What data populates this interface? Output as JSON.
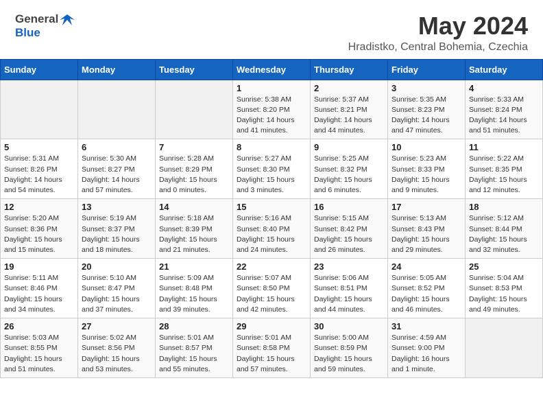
{
  "header": {
    "logo_general": "General",
    "logo_blue": "Blue",
    "month": "May 2024",
    "location": "Hradistko, Central Bohemia, Czechia"
  },
  "weekdays": [
    "Sunday",
    "Monday",
    "Tuesday",
    "Wednesday",
    "Thursday",
    "Friday",
    "Saturday"
  ],
  "weeks": [
    [
      {
        "day": "",
        "info": ""
      },
      {
        "day": "",
        "info": ""
      },
      {
        "day": "",
        "info": ""
      },
      {
        "day": "1",
        "info": "Sunrise: 5:38 AM\nSunset: 8:20 PM\nDaylight: 14 hours\nand 41 minutes."
      },
      {
        "day": "2",
        "info": "Sunrise: 5:37 AM\nSunset: 8:21 PM\nDaylight: 14 hours\nand 44 minutes."
      },
      {
        "day": "3",
        "info": "Sunrise: 5:35 AM\nSunset: 8:23 PM\nDaylight: 14 hours\nand 47 minutes."
      },
      {
        "day": "4",
        "info": "Sunrise: 5:33 AM\nSunset: 8:24 PM\nDaylight: 14 hours\nand 51 minutes."
      }
    ],
    [
      {
        "day": "5",
        "info": "Sunrise: 5:31 AM\nSunset: 8:26 PM\nDaylight: 14 hours\nand 54 minutes."
      },
      {
        "day": "6",
        "info": "Sunrise: 5:30 AM\nSunset: 8:27 PM\nDaylight: 14 hours\nand 57 minutes."
      },
      {
        "day": "7",
        "info": "Sunrise: 5:28 AM\nSunset: 8:29 PM\nDaylight: 15 hours\nand 0 minutes."
      },
      {
        "day": "8",
        "info": "Sunrise: 5:27 AM\nSunset: 8:30 PM\nDaylight: 15 hours\nand 3 minutes."
      },
      {
        "day": "9",
        "info": "Sunrise: 5:25 AM\nSunset: 8:32 PM\nDaylight: 15 hours\nand 6 minutes."
      },
      {
        "day": "10",
        "info": "Sunrise: 5:23 AM\nSunset: 8:33 PM\nDaylight: 15 hours\nand 9 minutes."
      },
      {
        "day": "11",
        "info": "Sunrise: 5:22 AM\nSunset: 8:35 PM\nDaylight: 15 hours\nand 12 minutes."
      }
    ],
    [
      {
        "day": "12",
        "info": "Sunrise: 5:20 AM\nSunset: 8:36 PM\nDaylight: 15 hours\nand 15 minutes."
      },
      {
        "day": "13",
        "info": "Sunrise: 5:19 AM\nSunset: 8:37 PM\nDaylight: 15 hours\nand 18 minutes."
      },
      {
        "day": "14",
        "info": "Sunrise: 5:18 AM\nSunset: 8:39 PM\nDaylight: 15 hours\nand 21 minutes."
      },
      {
        "day": "15",
        "info": "Sunrise: 5:16 AM\nSunset: 8:40 PM\nDaylight: 15 hours\nand 24 minutes."
      },
      {
        "day": "16",
        "info": "Sunrise: 5:15 AM\nSunset: 8:42 PM\nDaylight: 15 hours\nand 26 minutes."
      },
      {
        "day": "17",
        "info": "Sunrise: 5:13 AM\nSunset: 8:43 PM\nDaylight: 15 hours\nand 29 minutes."
      },
      {
        "day": "18",
        "info": "Sunrise: 5:12 AM\nSunset: 8:44 PM\nDaylight: 15 hours\nand 32 minutes."
      }
    ],
    [
      {
        "day": "19",
        "info": "Sunrise: 5:11 AM\nSunset: 8:46 PM\nDaylight: 15 hours\nand 34 minutes."
      },
      {
        "day": "20",
        "info": "Sunrise: 5:10 AM\nSunset: 8:47 PM\nDaylight: 15 hours\nand 37 minutes."
      },
      {
        "day": "21",
        "info": "Sunrise: 5:09 AM\nSunset: 8:48 PM\nDaylight: 15 hours\nand 39 minutes."
      },
      {
        "day": "22",
        "info": "Sunrise: 5:07 AM\nSunset: 8:50 PM\nDaylight: 15 hours\nand 42 minutes."
      },
      {
        "day": "23",
        "info": "Sunrise: 5:06 AM\nSunset: 8:51 PM\nDaylight: 15 hours\nand 44 minutes."
      },
      {
        "day": "24",
        "info": "Sunrise: 5:05 AM\nSunset: 8:52 PM\nDaylight: 15 hours\nand 46 minutes."
      },
      {
        "day": "25",
        "info": "Sunrise: 5:04 AM\nSunset: 8:53 PM\nDaylight: 15 hours\nand 49 minutes."
      }
    ],
    [
      {
        "day": "26",
        "info": "Sunrise: 5:03 AM\nSunset: 8:55 PM\nDaylight: 15 hours\nand 51 minutes."
      },
      {
        "day": "27",
        "info": "Sunrise: 5:02 AM\nSunset: 8:56 PM\nDaylight: 15 hours\nand 53 minutes."
      },
      {
        "day": "28",
        "info": "Sunrise: 5:01 AM\nSunset: 8:57 PM\nDaylight: 15 hours\nand 55 minutes."
      },
      {
        "day": "29",
        "info": "Sunrise: 5:01 AM\nSunset: 8:58 PM\nDaylight: 15 hours\nand 57 minutes."
      },
      {
        "day": "30",
        "info": "Sunrise: 5:00 AM\nSunset: 8:59 PM\nDaylight: 15 hours\nand 59 minutes."
      },
      {
        "day": "31",
        "info": "Sunrise: 4:59 AM\nSunset: 9:00 PM\nDaylight: 16 hours\nand 1 minute."
      },
      {
        "day": "",
        "info": ""
      }
    ]
  ]
}
